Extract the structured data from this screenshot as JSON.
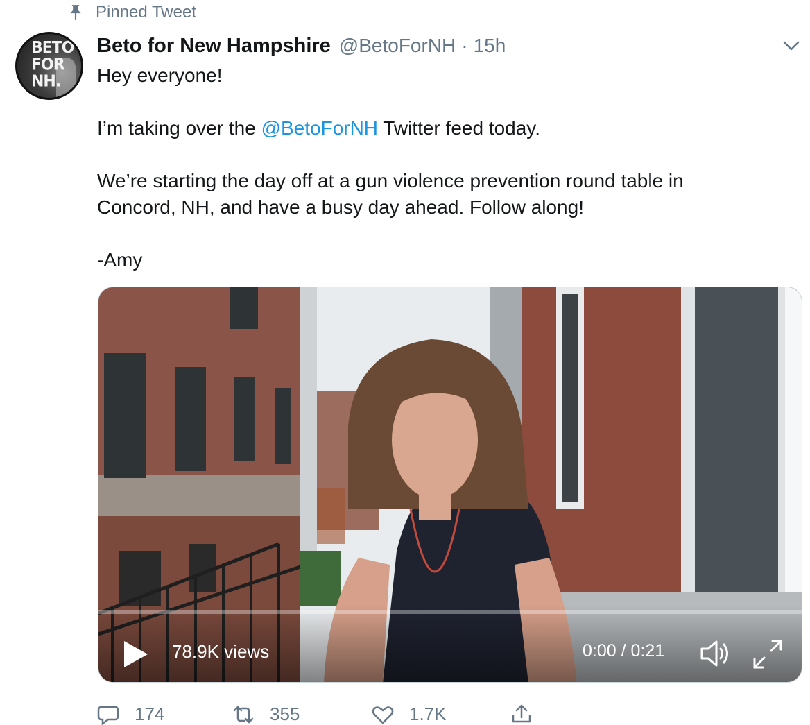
{
  "pinned": {
    "label": "Pinned Tweet",
    "icon": "pin-icon"
  },
  "author": {
    "display_name": "Beto for New Hampshire",
    "handle": "@BetoForNH",
    "separator": "·",
    "time": "15h",
    "avatar_text": [
      "BETO",
      "FOR",
      "NH."
    ]
  },
  "tweet": {
    "line1": "Hey everyone!",
    "line2_before": "I’m taking over the ",
    "line2_mention": "@BetoForNH",
    "line2_after": " Twitter feed today.",
    "line3": "We’re starting the day off at a gun violence prevention round table in",
    "line4": "Concord, NH, and have a busy day ahead. Follow along!",
    "line5": "-Amy"
  },
  "video": {
    "views": "78.9K views",
    "timecode": "0:00 / 0:21",
    "progress": 0.0,
    "controls": [
      "play-icon",
      "volume-icon",
      "fullscreen-icon"
    ]
  },
  "actions": {
    "reply_count": "174",
    "retweet_count": "355",
    "like_count": "1.7K"
  },
  "colors": {
    "link": "#1b95e0",
    "secondary": "#657786",
    "text": "#14171a"
  }
}
